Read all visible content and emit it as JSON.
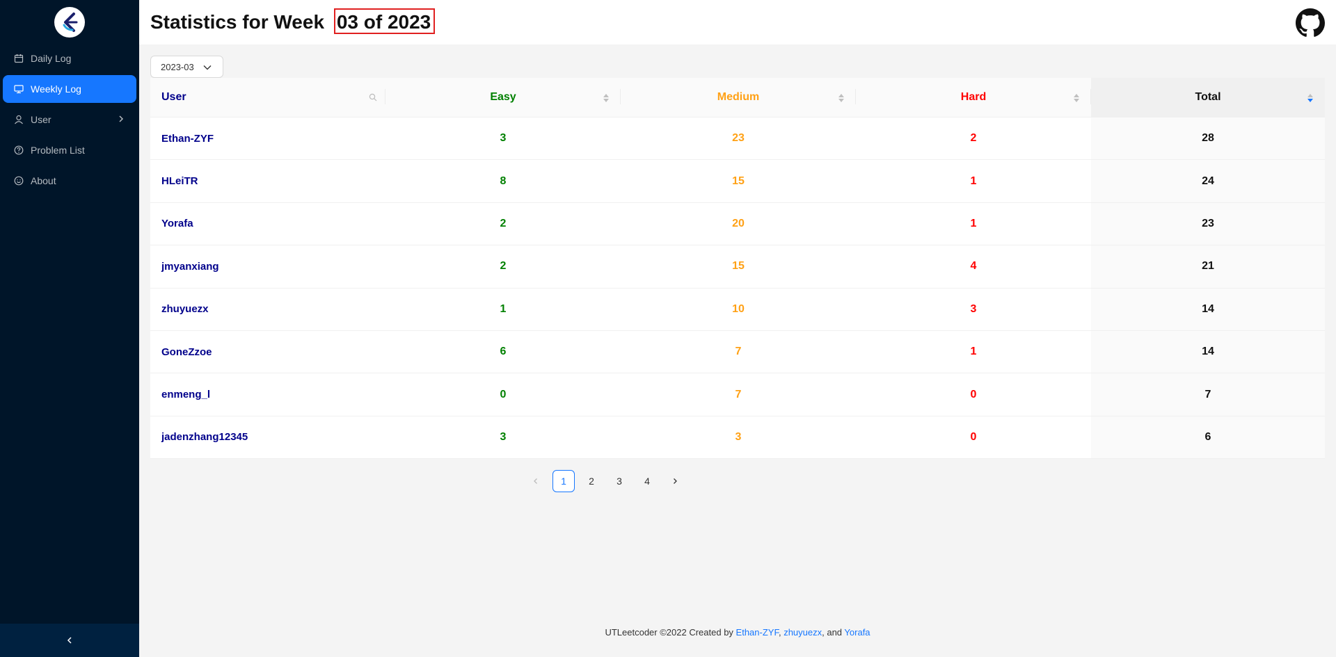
{
  "sidebar": {
    "items": [
      {
        "label": "Daily Log",
        "icon": "calendar-icon"
      },
      {
        "label": "Weekly Log",
        "icon": "monitor-icon"
      },
      {
        "label": "User",
        "icon": "user-icon"
      },
      {
        "label": "Problem List",
        "icon": "question-icon"
      },
      {
        "label": "About",
        "icon": "smile-icon"
      }
    ]
  },
  "header": {
    "title_prefix": "Statistics for Week",
    "title_highlight": "03 of 2023"
  },
  "week_select": {
    "value": "2023-03"
  },
  "table": {
    "columns": [
      "User",
      "Easy",
      "Medium",
      "Hard",
      "Total"
    ],
    "rows": [
      {
        "user": "Ethan-ZYF",
        "easy": "3",
        "medium": "23",
        "hard": "2",
        "total": "28"
      },
      {
        "user": "HLeiTR",
        "easy": "8",
        "medium": "15",
        "hard": "1",
        "total": "24"
      },
      {
        "user": "Yorafa",
        "easy": "2",
        "medium": "20",
        "hard": "1",
        "total": "23"
      },
      {
        "user": "jmyanxiang",
        "easy": "2",
        "medium": "15",
        "hard": "4",
        "total": "21"
      },
      {
        "user": "zhuyuezx",
        "easy": "1",
        "medium": "10",
        "hard": "3",
        "total": "14"
      },
      {
        "user": "GoneZzoe",
        "easy": "6",
        "medium": "7",
        "hard": "1",
        "total": "14"
      },
      {
        "user": "enmeng_l",
        "easy": "0",
        "medium": "7",
        "hard": "0",
        "total": "7"
      },
      {
        "user": "jadenzhang12345",
        "easy": "3",
        "medium": "3",
        "hard": "0",
        "total": "6"
      }
    ]
  },
  "pagination": {
    "pages": [
      "1",
      "2",
      "3",
      "4"
    ],
    "current": "1"
  },
  "footer": {
    "prefix": "UTLeetcoder ©2022 Created by ",
    "author1": "Ethan-ZYF",
    "sep1": ", ",
    "author2": "zhuyuezx",
    "sep2": ", and ",
    "author3": "Yorafa"
  },
  "colors": {
    "sidebar_bg": "#001529",
    "accent": "#1677ff",
    "easy": "#008000",
    "medium": "#ffa116",
    "hard": "#ff0000",
    "user_link": "#00008b",
    "highlight_box": "#e02020"
  }
}
